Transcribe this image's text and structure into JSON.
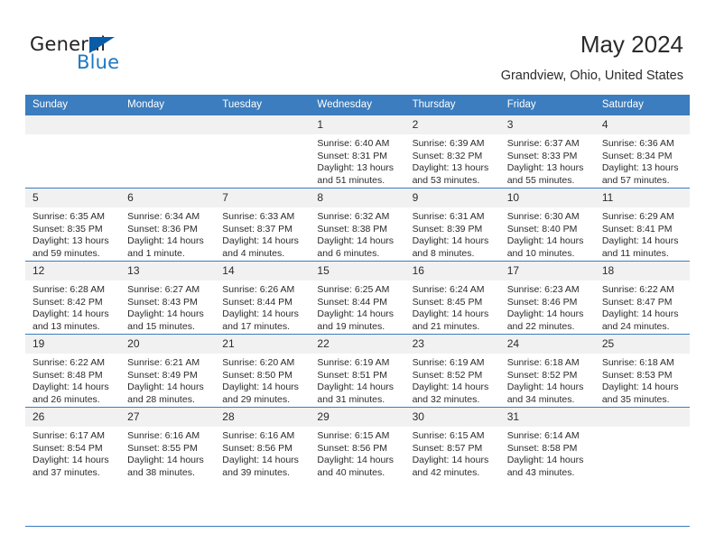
{
  "brand": {
    "name_top": "General",
    "name_bottom": "Blue",
    "accent_color": "#1f78c1",
    "triangle_color": "#0a5ca8"
  },
  "header": {
    "title": "May 2024",
    "subtitle": "Grandview, Ohio, United States"
  },
  "calendar": {
    "header_bg": "#3b7dbf",
    "daynum_bg": "#f1f1f1",
    "weekdays": [
      "Sunday",
      "Monday",
      "Tuesday",
      "Wednesday",
      "Thursday",
      "Friday",
      "Saturday"
    ],
    "weeks": [
      [
        {
          "day": "",
          "sunrise": "",
          "sunset": "",
          "daylight1": "",
          "daylight2": ""
        },
        {
          "day": "",
          "sunrise": "",
          "sunset": "",
          "daylight1": "",
          "daylight2": ""
        },
        {
          "day": "",
          "sunrise": "",
          "sunset": "",
          "daylight1": "",
          "daylight2": ""
        },
        {
          "day": "1",
          "sunrise": "Sunrise: 6:40 AM",
          "sunset": "Sunset: 8:31 PM",
          "daylight1": "Daylight: 13 hours",
          "daylight2": "and 51 minutes."
        },
        {
          "day": "2",
          "sunrise": "Sunrise: 6:39 AM",
          "sunset": "Sunset: 8:32 PM",
          "daylight1": "Daylight: 13 hours",
          "daylight2": "and 53 minutes."
        },
        {
          "day": "3",
          "sunrise": "Sunrise: 6:37 AM",
          "sunset": "Sunset: 8:33 PM",
          "daylight1": "Daylight: 13 hours",
          "daylight2": "and 55 minutes."
        },
        {
          "day": "4",
          "sunrise": "Sunrise: 6:36 AM",
          "sunset": "Sunset: 8:34 PM",
          "daylight1": "Daylight: 13 hours",
          "daylight2": "and 57 minutes."
        }
      ],
      [
        {
          "day": "5",
          "sunrise": "Sunrise: 6:35 AM",
          "sunset": "Sunset: 8:35 PM",
          "daylight1": "Daylight: 13 hours",
          "daylight2": "and 59 minutes."
        },
        {
          "day": "6",
          "sunrise": "Sunrise: 6:34 AM",
          "sunset": "Sunset: 8:36 PM",
          "daylight1": "Daylight: 14 hours",
          "daylight2": "and 1 minute."
        },
        {
          "day": "7",
          "sunrise": "Sunrise: 6:33 AM",
          "sunset": "Sunset: 8:37 PM",
          "daylight1": "Daylight: 14 hours",
          "daylight2": "and 4 minutes."
        },
        {
          "day": "8",
          "sunrise": "Sunrise: 6:32 AM",
          "sunset": "Sunset: 8:38 PM",
          "daylight1": "Daylight: 14 hours",
          "daylight2": "and 6 minutes."
        },
        {
          "day": "9",
          "sunrise": "Sunrise: 6:31 AM",
          "sunset": "Sunset: 8:39 PM",
          "daylight1": "Daylight: 14 hours",
          "daylight2": "and 8 minutes."
        },
        {
          "day": "10",
          "sunrise": "Sunrise: 6:30 AM",
          "sunset": "Sunset: 8:40 PM",
          "daylight1": "Daylight: 14 hours",
          "daylight2": "and 10 minutes."
        },
        {
          "day": "11",
          "sunrise": "Sunrise: 6:29 AM",
          "sunset": "Sunset: 8:41 PM",
          "daylight1": "Daylight: 14 hours",
          "daylight2": "and 11 minutes."
        }
      ],
      [
        {
          "day": "12",
          "sunrise": "Sunrise: 6:28 AM",
          "sunset": "Sunset: 8:42 PM",
          "daylight1": "Daylight: 14 hours",
          "daylight2": "and 13 minutes."
        },
        {
          "day": "13",
          "sunrise": "Sunrise: 6:27 AM",
          "sunset": "Sunset: 8:43 PM",
          "daylight1": "Daylight: 14 hours",
          "daylight2": "and 15 minutes."
        },
        {
          "day": "14",
          "sunrise": "Sunrise: 6:26 AM",
          "sunset": "Sunset: 8:44 PM",
          "daylight1": "Daylight: 14 hours",
          "daylight2": "and 17 minutes."
        },
        {
          "day": "15",
          "sunrise": "Sunrise: 6:25 AM",
          "sunset": "Sunset: 8:44 PM",
          "daylight1": "Daylight: 14 hours",
          "daylight2": "and 19 minutes."
        },
        {
          "day": "16",
          "sunrise": "Sunrise: 6:24 AM",
          "sunset": "Sunset: 8:45 PM",
          "daylight1": "Daylight: 14 hours",
          "daylight2": "and 21 minutes."
        },
        {
          "day": "17",
          "sunrise": "Sunrise: 6:23 AM",
          "sunset": "Sunset: 8:46 PM",
          "daylight1": "Daylight: 14 hours",
          "daylight2": "and 22 minutes."
        },
        {
          "day": "18",
          "sunrise": "Sunrise: 6:22 AM",
          "sunset": "Sunset: 8:47 PM",
          "daylight1": "Daylight: 14 hours",
          "daylight2": "and 24 minutes."
        }
      ],
      [
        {
          "day": "19",
          "sunrise": "Sunrise: 6:22 AM",
          "sunset": "Sunset: 8:48 PM",
          "daylight1": "Daylight: 14 hours",
          "daylight2": "and 26 minutes."
        },
        {
          "day": "20",
          "sunrise": "Sunrise: 6:21 AM",
          "sunset": "Sunset: 8:49 PM",
          "daylight1": "Daylight: 14 hours",
          "daylight2": "and 28 minutes."
        },
        {
          "day": "21",
          "sunrise": "Sunrise: 6:20 AM",
          "sunset": "Sunset: 8:50 PM",
          "daylight1": "Daylight: 14 hours",
          "daylight2": "and 29 minutes."
        },
        {
          "day": "22",
          "sunrise": "Sunrise: 6:19 AM",
          "sunset": "Sunset: 8:51 PM",
          "daylight1": "Daylight: 14 hours",
          "daylight2": "and 31 minutes."
        },
        {
          "day": "23",
          "sunrise": "Sunrise: 6:19 AM",
          "sunset": "Sunset: 8:52 PM",
          "daylight1": "Daylight: 14 hours",
          "daylight2": "and 32 minutes."
        },
        {
          "day": "24",
          "sunrise": "Sunrise: 6:18 AM",
          "sunset": "Sunset: 8:52 PM",
          "daylight1": "Daylight: 14 hours",
          "daylight2": "and 34 minutes."
        },
        {
          "day": "25",
          "sunrise": "Sunrise: 6:18 AM",
          "sunset": "Sunset: 8:53 PM",
          "daylight1": "Daylight: 14 hours",
          "daylight2": "and 35 minutes."
        }
      ],
      [
        {
          "day": "26",
          "sunrise": "Sunrise: 6:17 AM",
          "sunset": "Sunset: 8:54 PM",
          "daylight1": "Daylight: 14 hours",
          "daylight2": "and 37 minutes."
        },
        {
          "day": "27",
          "sunrise": "Sunrise: 6:16 AM",
          "sunset": "Sunset: 8:55 PM",
          "daylight1": "Daylight: 14 hours",
          "daylight2": "and 38 minutes."
        },
        {
          "day": "28",
          "sunrise": "Sunrise: 6:16 AM",
          "sunset": "Sunset: 8:56 PM",
          "daylight1": "Daylight: 14 hours",
          "daylight2": "and 39 minutes."
        },
        {
          "day": "29",
          "sunrise": "Sunrise: 6:15 AM",
          "sunset": "Sunset: 8:56 PM",
          "daylight1": "Daylight: 14 hours",
          "daylight2": "and 40 minutes."
        },
        {
          "day": "30",
          "sunrise": "Sunrise: 6:15 AM",
          "sunset": "Sunset: 8:57 PM",
          "daylight1": "Daylight: 14 hours",
          "daylight2": "and 42 minutes."
        },
        {
          "day": "31",
          "sunrise": "Sunrise: 6:14 AM",
          "sunset": "Sunset: 8:58 PM",
          "daylight1": "Daylight: 14 hours",
          "daylight2": "and 43 minutes."
        },
        {
          "day": "",
          "sunrise": "",
          "sunset": "",
          "daylight1": "",
          "daylight2": ""
        }
      ]
    ]
  }
}
